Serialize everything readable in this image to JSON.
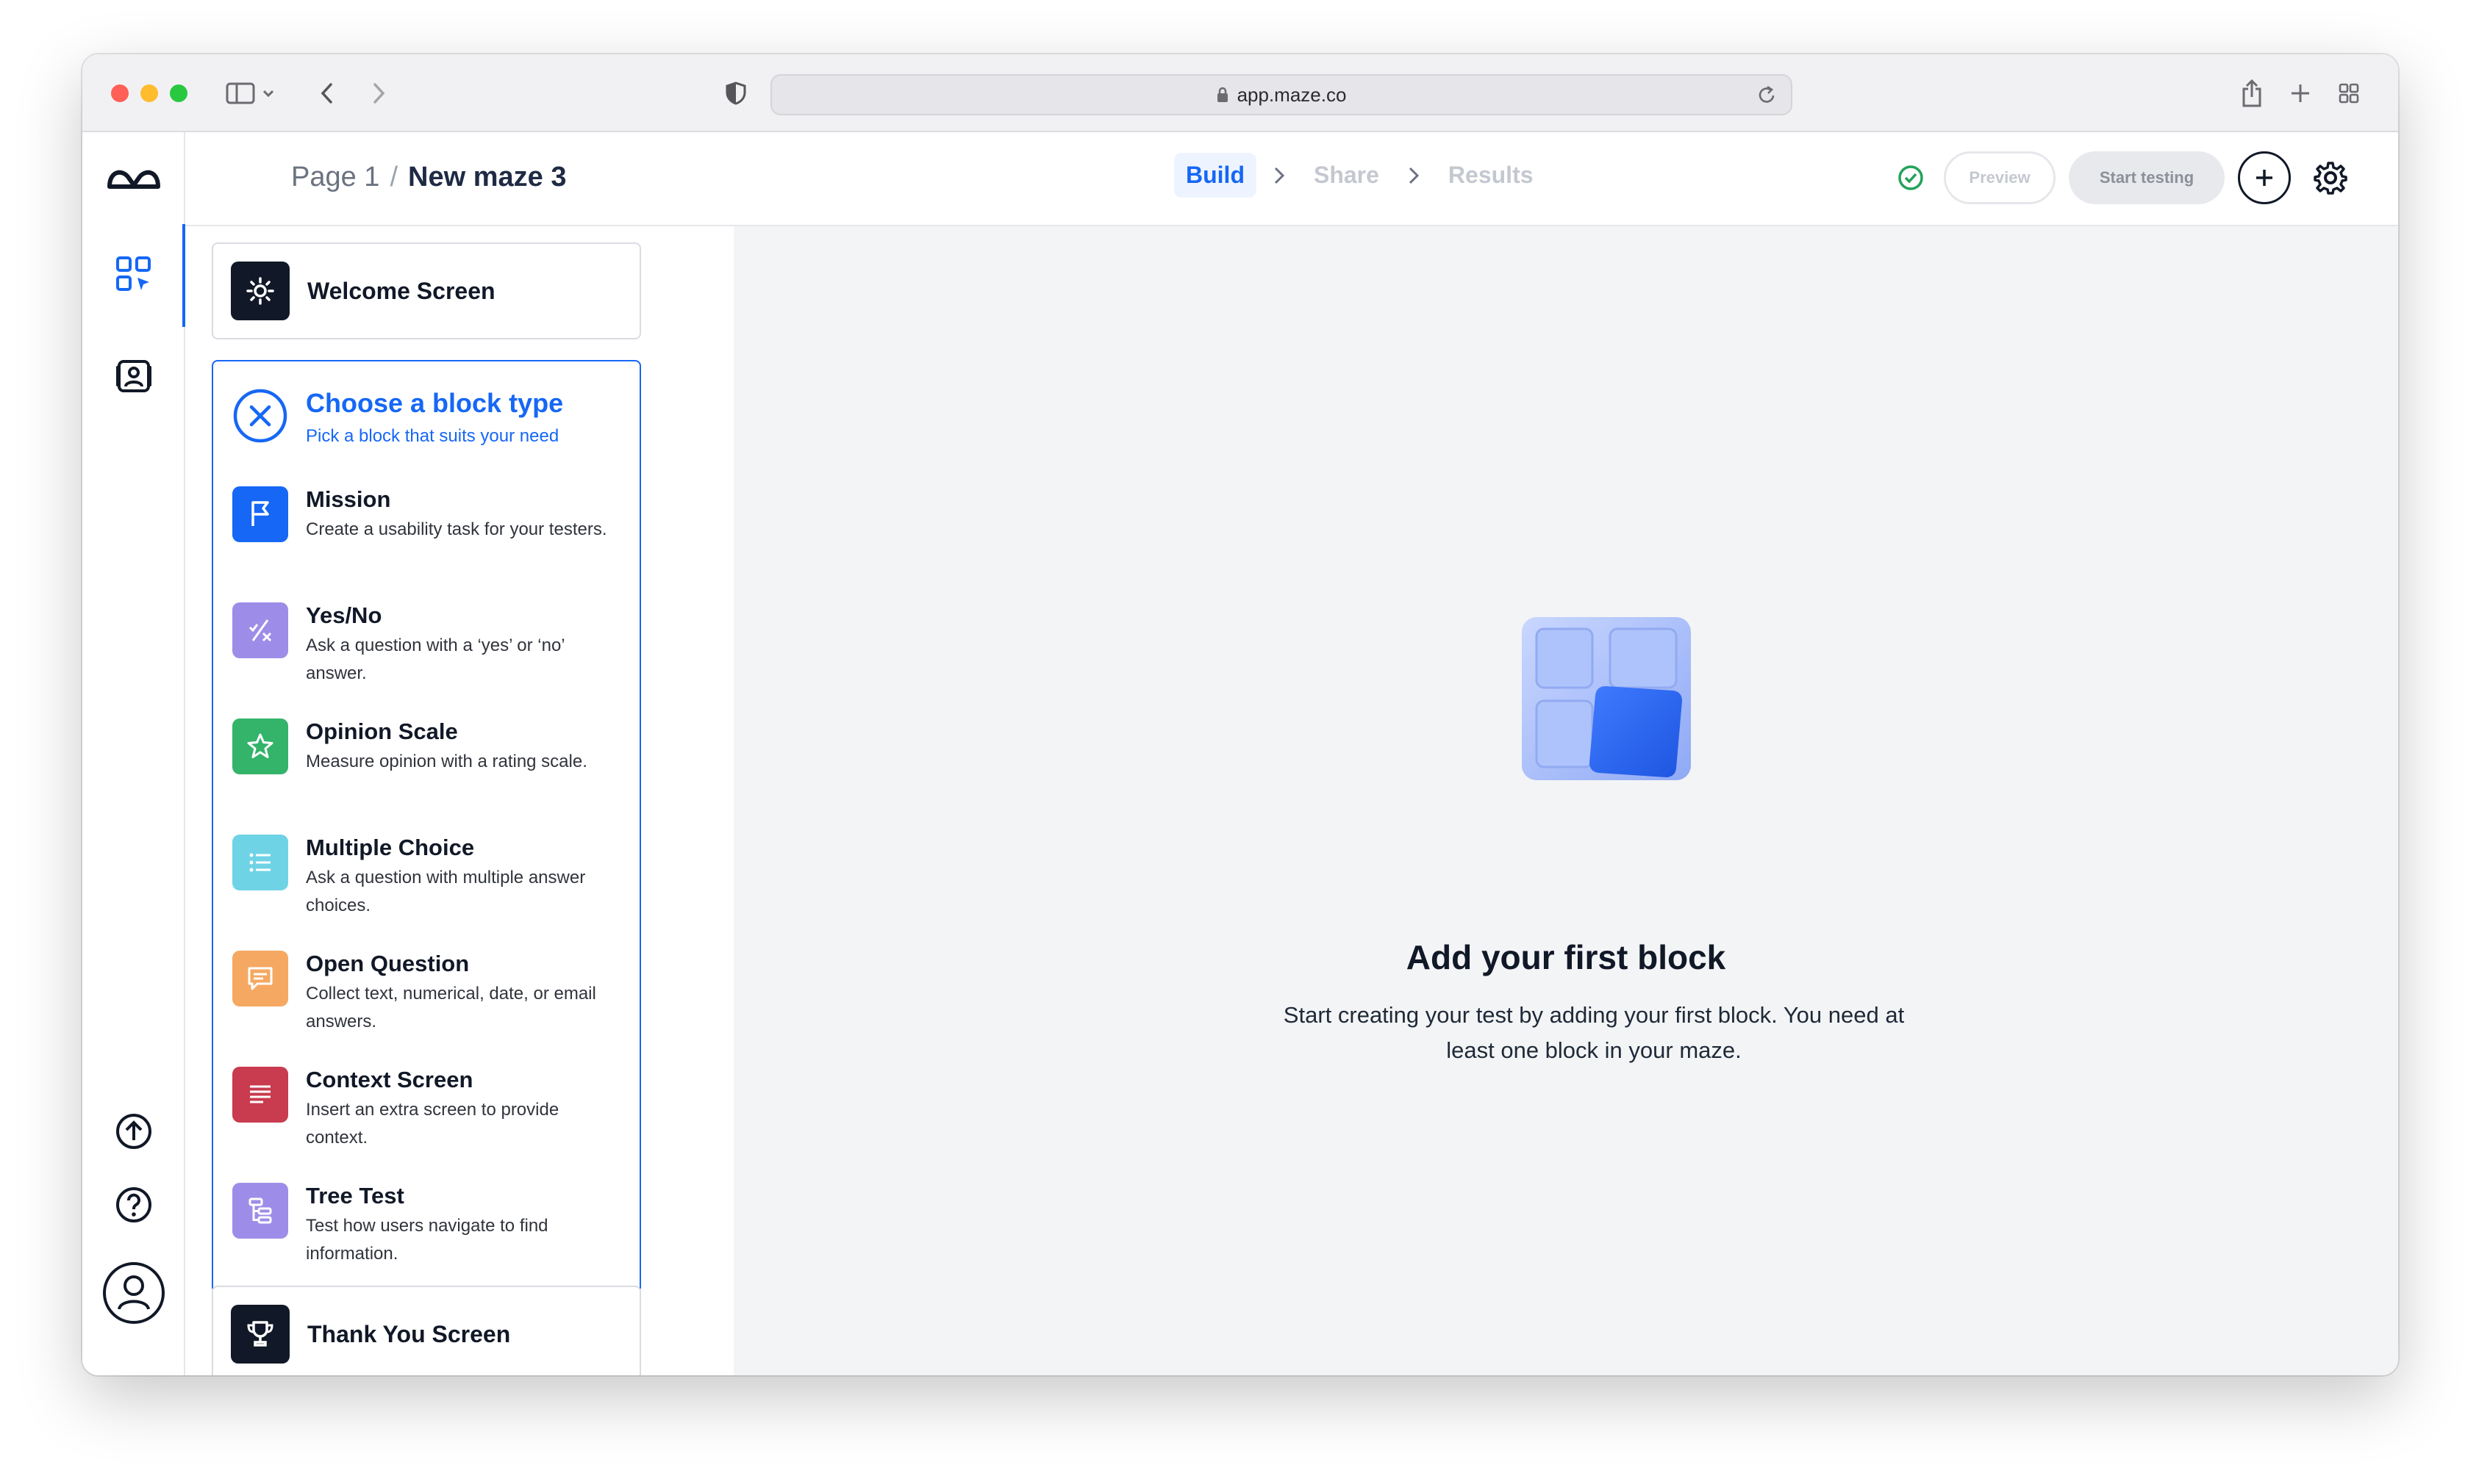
{
  "browser": {
    "url": "app.maze.co"
  },
  "breadcrumb": {
    "page": "Page 1",
    "separator": "/",
    "maze_name": "New maze 3"
  },
  "steps": [
    {
      "label": "Build",
      "active": true
    },
    {
      "label": "Share",
      "active": false
    },
    {
      "label": "Results",
      "active": false
    }
  ],
  "toolbar": {
    "preview_label": "Preview",
    "start_label": "Start testing",
    "status": "saved",
    "status_color": "#22a35a"
  },
  "blocks": {
    "welcome": {
      "label": "Welcome Screen",
      "icon": "sun-icon"
    },
    "thank_you": {
      "label": "Thank You Screen",
      "icon": "trophy-icon"
    }
  },
  "chooser": {
    "title": "Choose a block type",
    "subtitle": "Pick a block that suits your need",
    "accent": "#1667f5",
    "options": [
      {
        "name": "Mission",
        "desc": "Create a usability task for your testers.",
        "icon": "flag-icon",
        "color": "#1667f5"
      },
      {
        "name": "Yes/No",
        "desc": "Ask a question with a ‘yes’ or ‘no’ answer.",
        "icon": "yes-no-icon",
        "color": "#9e8de8"
      },
      {
        "name": "Opinion Scale",
        "desc": "Measure opinion with a rating scale.",
        "icon": "star-icon",
        "color": "#34b36b"
      },
      {
        "name": "Multiple Choice",
        "desc": "Ask a question with multiple answer choices.",
        "icon": "list-icon",
        "color": "#6fd3e6"
      },
      {
        "name": "Open Question",
        "desc": "Collect text, numerical, date, or email answers.",
        "icon": "chat-icon",
        "color": "#f5a862"
      },
      {
        "name": "Context Screen",
        "desc": "Insert an extra screen to provide context.",
        "icon": "text-lines-icon",
        "color": "#c93b4e"
      },
      {
        "name": "Tree Test",
        "desc": "Test how users navigate to find information.",
        "icon": "tree-icon",
        "color": "#9e8de8"
      }
    ]
  },
  "empty_state": {
    "title": "Add your first block",
    "description": "Start creating your test by adding your first block. You need at least one block in your maze."
  }
}
